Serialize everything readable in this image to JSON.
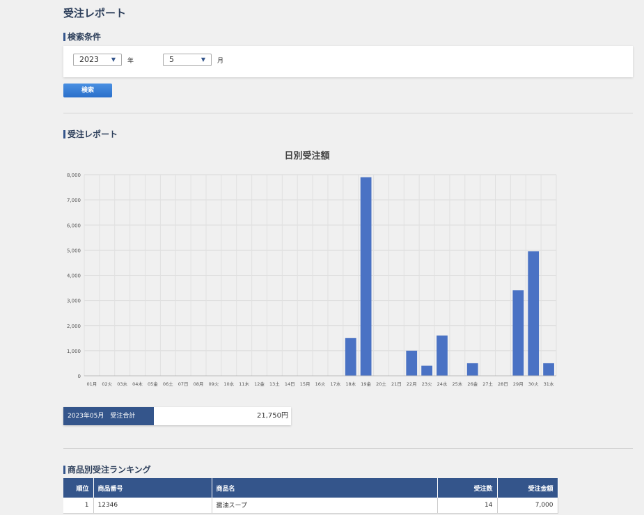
{
  "page_title": "受注レポート",
  "search": {
    "heading": "検索条件",
    "year_value": "2023",
    "year_unit": "年",
    "month_value": "5",
    "month_unit": "月",
    "button_label": "検索"
  },
  "report": {
    "heading": "受注レポート",
    "total_label": "2023年05月　受注合計",
    "total_value": "21,750円"
  },
  "chart_data": {
    "type": "bar",
    "title": "日別受注額",
    "categories": [
      "01月",
      "02火",
      "03水",
      "04木",
      "05金",
      "06土",
      "07日",
      "08月",
      "09火",
      "10水",
      "11木",
      "12金",
      "13土",
      "14日",
      "15月",
      "16火",
      "17水",
      "18木",
      "19金",
      "20土",
      "21日",
      "22月",
      "23火",
      "24水",
      "25木",
      "26金",
      "27土",
      "28日",
      "29月",
      "30火",
      "31水"
    ],
    "values": [
      0,
      0,
      0,
      0,
      0,
      0,
      0,
      0,
      0,
      0,
      0,
      0,
      0,
      0,
      0,
      0,
      0,
      1500,
      7900,
      0,
      0,
      1000,
      400,
      1600,
      0,
      500,
      0,
      0,
      3400,
      4950,
      500
    ],
    "ylim": [
      0,
      8000
    ],
    "yticks": [
      "0",
      "1,000",
      "2,000",
      "3,000",
      "4,000",
      "5,000",
      "6,000",
      "7,000",
      "8,000"
    ],
    "grid": true,
    "bar_color": "#4a72c4"
  },
  "ranking": {
    "heading": "商品別受注ランキング",
    "columns": [
      "順位",
      "商品番号",
      "商品名",
      "受注数",
      "受注金額"
    ],
    "rows": [
      {
        "rank": "1",
        "code": "12346",
        "name": "醤油スープ",
        "qty": "14",
        "amount": "7,000"
      }
    ]
  },
  "colors": {
    "header_bg": "#34558b",
    "button": "#3a80d6"
  }
}
